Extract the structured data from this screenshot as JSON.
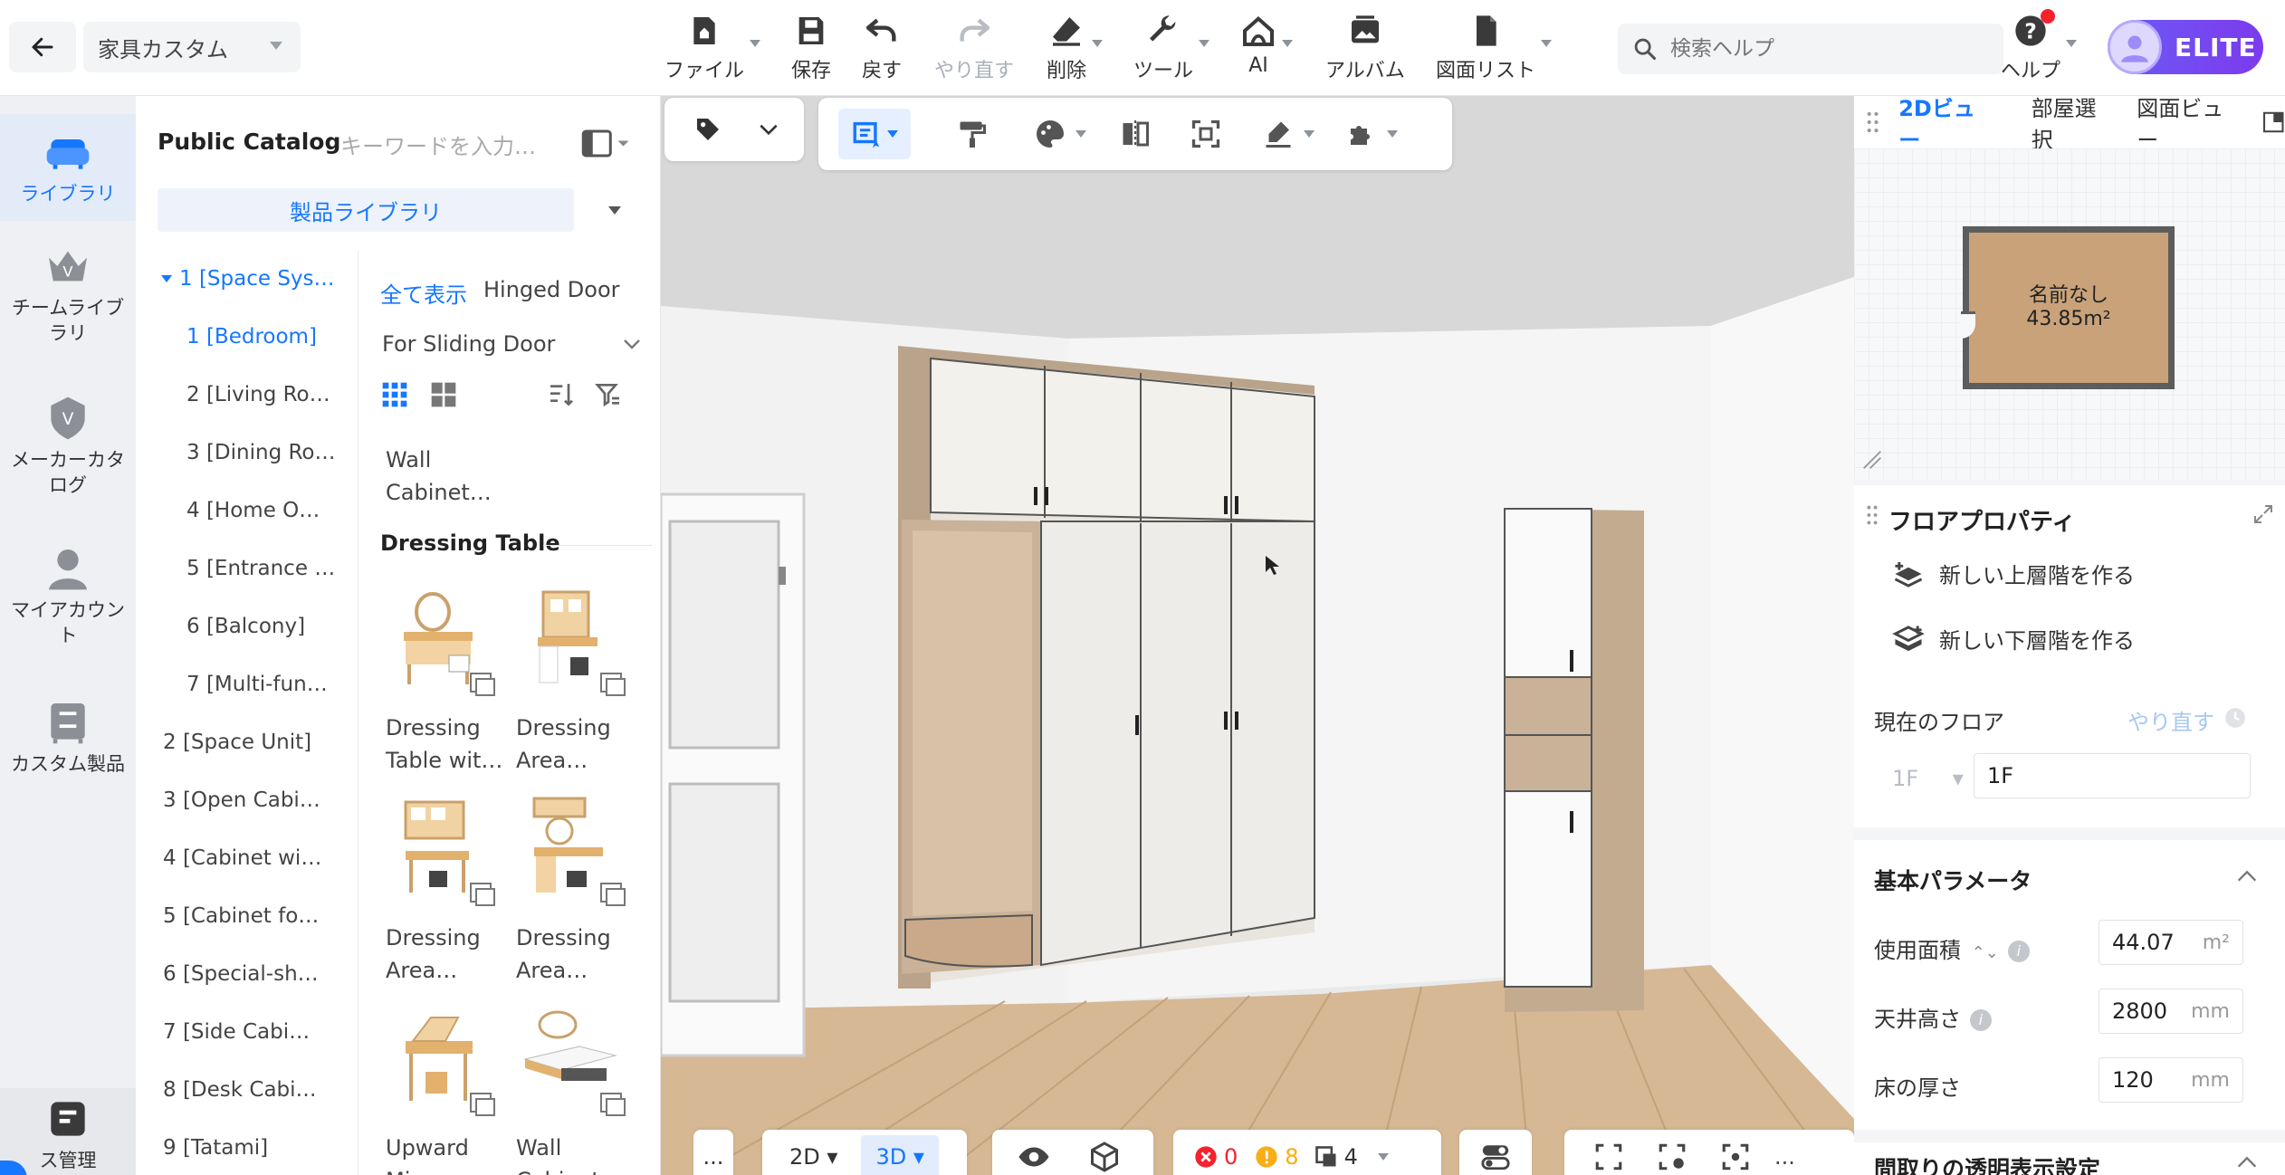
{
  "header": {
    "project_name": "家具カスタム",
    "tools": {
      "file": "ファイル",
      "save": "保存",
      "undo": "戻す",
      "redo": "やり直す",
      "delete": "削除",
      "tools": "ツール",
      "ai": "AI",
      "album": "アルバム",
      "drawings": "図面リスト"
    },
    "search_placeholder": "検索ヘルプ",
    "help": "ヘルプ",
    "badge": "ELITE"
  },
  "rail": {
    "library": "ライブラリ",
    "team_library": "チームライブラリ",
    "maker_catalog": "メーカーカタログ",
    "my_account": "マイアカウント",
    "custom_products": "カスタム製品",
    "management": "ス管理"
  },
  "catalog": {
    "title": "Public Catalog",
    "keyword_placeholder": "キーワードを入力…",
    "library_select": "製品ライブラリ",
    "tree": [
      "1 [Space Sys…",
      "1 [Bedroom]",
      "2 [Living Ro…",
      "3 [Dining Ro…",
      "4 [Home O…",
      "5 [Entrance …",
      "6 [Balcony]",
      "7 [Multi-fun…",
      "2 [Space Unit]",
      "3 [Open Cabi…",
      "4 [Cabinet wi…",
      "5 [Cabinet fo…",
      "6 [Special-sh…",
      "7 [Side Cabi…",
      "8 [Desk Cabi…",
      "9 [Tatami]"
    ],
    "filters": {
      "show_all": "全て表示",
      "hinged": "Hinged Door",
      "sliding": "For Sliding Door"
    },
    "first_item": [
      "Wall",
      "Cabinet…"
    ],
    "section": "Dressing Table",
    "items": [
      [
        "Dressing",
        "Table wit…"
      ],
      [
        "Dressing",
        "Area…"
      ],
      [
        "Dressing",
        "Area…"
      ],
      [
        "Dressing",
        "Area…"
      ],
      [
        "Upward",
        "Mirror…"
      ],
      [
        "Wall",
        "Cabinet…"
      ]
    ]
  },
  "viewport": {
    "view_2d": "2D",
    "view_3d": "3D",
    "errors": "0",
    "warnings": "8",
    "count": "4",
    "more": "..."
  },
  "right_panel": {
    "tabs": [
      "2Dビュー",
      "部屋選択",
      "図面ビュー"
    ],
    "room_name": "名前なし",
    "room_area": "43.85m²",
    "props_title": "フロアプロパティ",
    "new_upper": "新しい上層階を作る",
    "new_lower": "新しい下層階を作る",
    "current_floor": "現在のフロア",
    "redo": "やり直す",
    "floor_select": "1F",
    "floor_name": "1F",
    "basic_params": "基本パラメータ",
    "area_label": "使用面積",
    "area_value": "44.07",
    "area_unit": "m²",
    "ceiling_label": "天井高さ",
    "ceiling_value": "2800",
    "ceiling_unit": "mm",
    "floor_thickness_label": "床の厚さ",
    "floor_thickness_value": "120",
    "floor_thickness_unit": "mm",
    "transparency_section": "間取りの透明表示設定"
  },
  "colors": {
    "accent": "#1677ff",
    "elite_gradient": "#6b5cf6",
    "error": "#f5222d",
    "warning": "#faad14"
  }
}
